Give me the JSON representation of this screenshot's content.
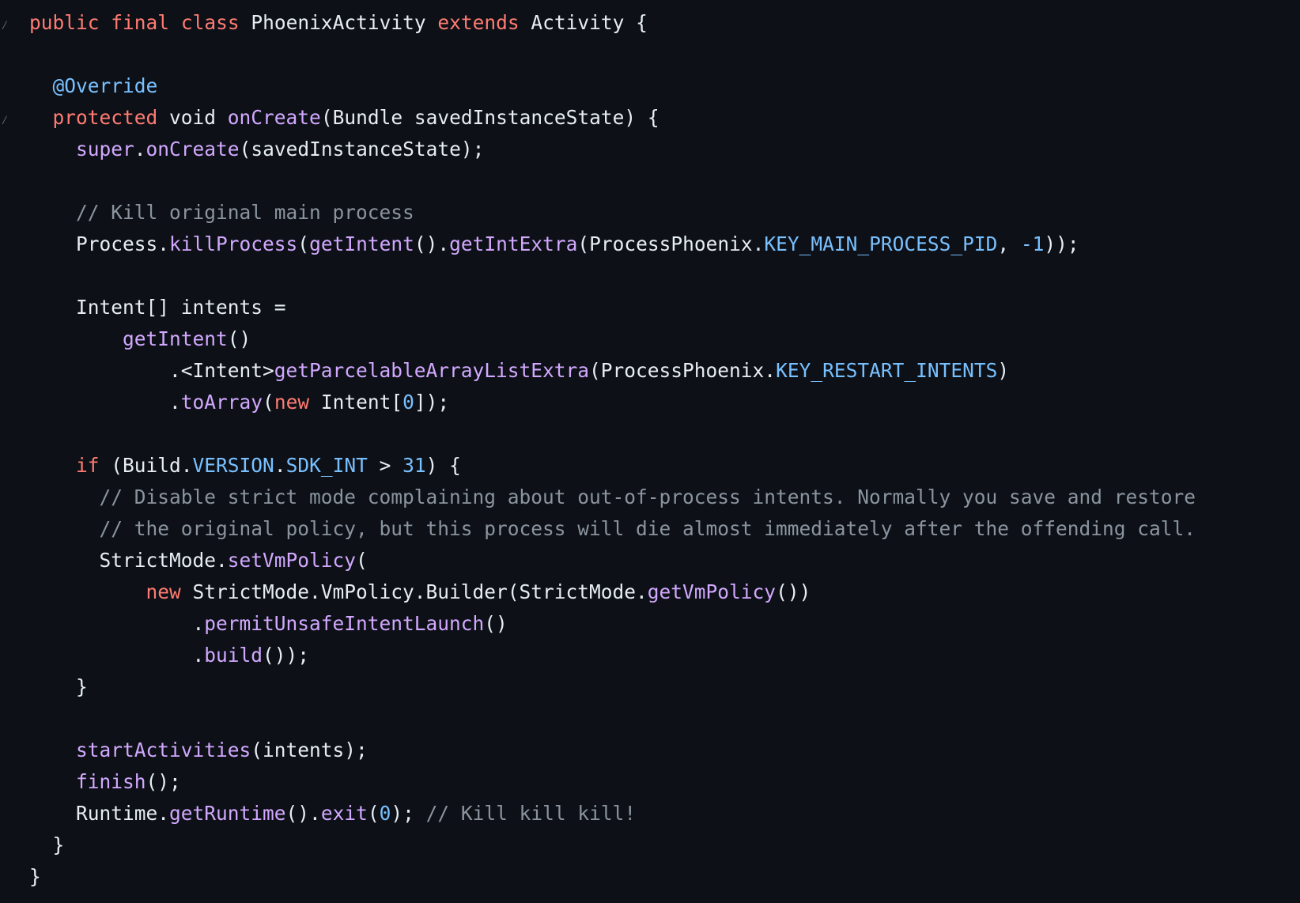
{
  "theme": {
    "background": "#0d1117",
    "text": "#e6edf3",
    "keyword": "#ff7b72",
    "function": "#d2a8ff",
    "constant": "#79c0ff",
    "comment": "#8b949e"
  },
  "code": {
    "language": "java",
    "fold_icon": "fold-chevron-icon",
    "lines": [
      {
        "fold": true,
        "indent": "",
        "tokens": [
          {
            "t": "public",
            "k": "kw"
          },
          {
            "t": " ",
            "k": "pl"
          },
          {
            "t": "final",
            "k": "kw"
          },
          {
            "t": " ",
            "k": "pl"
          },
          {
            "t": "class",
            "k": "kw"
          },
          {
            "t": " PhoenixActivity ",
            "k": "pl"
          },
          {
            "t": "extends",
            "k": "kw"
          },
          {
            "t": " Activity {",
            "k": "pl"
          }
        ]
      },
      {
        "fold": false,
        "indent": "",
        "tokens": []
      },
      {
        "fold": false,
        "indent": "  ",
        "tokens": [
          {
            "t": "@Override",
            "k": "an"
          }
        ]
      },
      {
        "fold": true,
        "indent": "  ",
        "tokens": [
          {
            "t": "protected",
            "k": "kw"
          },
          {
            "t": " void ",
            "k": "pl"
          },
          {
            "t": "onCreate",
            "k": "fn"
          },
          {
            "t": "(Bundle savedInstanceState) {",
            "k": "pl"
          }
        ]
      },
      {
        "fold": false,
        "indent": "    ",
        "tokens": [
          {
            "t": "super",
            "k": "fn"
          },
          {
            "t": ".",
            "k": "pl"
          },
          {
            "t": "onCreate",
            "k": "fn"
          },
          {
            "t": "(savedInstanceState);",
            "k": "pl"
          }
        ]
      },
      {
        "fold": false,
        "indent": "",
        "tokens": []
      },
      {
        "fold": false,
        "indent": "    ",
        "tokens": [
          {
            "t": "// Kill original main process",
            "k": "cm"
          }
        ]
      },
      {
        "fold": false,
        "indent": "    ",
        "tokens": [
          {
            "t": "Process.",
            "k": "pl"
          },
          {
            "t": "killProcess",
            "k": "fn"
          },
          {
            "t": "(",
            "k": "pl"
          },
          {
            "t": "getIntent",
            "k": "fn"
          },
          {
            "t": "().",
            "k": "pl"
          },
          {
            "t": "getIntExtra",
            "k": "fn"
          },
          {
            "t": "(ProcessPhoenix.",
            "k": "pl"
          },
          {
            "t": "KEY_MAIN_PROCESS_PID",
            "k": "cst"
          },
          {
            "t": ", ",
            "k": "pl"
          },
          {
            "t": "-1",
            "k": "num"
          },
          {
            "t": "));",
            "k": "pl"
          }
        ]
      },
      {
        "fold": false,
        "indent": "",
        "tokens": []
      },
      {
        "fold": false,
        "indent": "    ",
        "tokens": [
          {
            "t": "Intent[] intents =",
            "k": "pl"
          }
        ]
      },
      {
        "fold": false,
        "indent": "        ",
        "tokens": [
          {
            "t": "getIntent",
            "k": "fn"
          },
          {
            "t": "()",
            "k": "pl"
          }
        ]
      },
      {
        "fold": false,
        "indent": "            ",
        "tokens": [
          {
            "t": ".<Intent>",
            "k": "pl"
          },
          {
            "t": "getParcelableArrayListExtra",
            "k": "fn"
          },
          {
            "t": "(ProcessPhoenix.",
            "k": "pl"
          },
          {
            "t": "KEY_RESTART_INTENTS",
            "k": "cst"
          },
          {
            "t": ")",
            "k": "pl"
          }
        ]
      },
      {
        "fold": false,
        "indent": "            ",
        "tokens": [
          {
            "t": ".",
            "k": "pl"
          },
          {
            "t": "toArray",
            "k": "fn"
          },
          {
            "t": "(",
            "k": "pl"
          },
          {
            "t": "new",
            "k": "kw"
          },
          {
            "t": " Intent[",
            "k": "pl"
          },
          {
            "t": "0",
            "k": "num"
          },
          {
            "t": "]);",
            "k": "pl"
          }
        ]
      },
      {
        "fold": false,
        "indent": "",
        "tokens": []
      },
      {
        "fold": false,
        "indent": "    ",
        "tokens": [
          {
            "t": "if",
            "k": "kw"
          },
          {
            "t": " (Build.",
            "k": "pl"
          },
          {
            "t": "VERSION",
            "k": "cst"
          },
          {
            "t": ".",
            "k": "pl"
          },
          {
            "t": "SDK_INT",
            "k": "cst"
          },
          {
            "t": " > ",
            "k": "pl"
          },
          {
            "t": "31",
            "k": "num"
          },
          {
            "t": ") {",
            "k": "pl"
          }
        ]
      },
      {
        "fold": false,
        "indent": "      ",
        "tokens": [
          {
            "t": "// Disable strict mode complaining about out-of-process intents. Normally you save and restore",
            "k": "cm"
          }
        ]
      },
      {
        "fold": false,
        "indent": "      ",
        "tokens": [
          {
            "t": "// the original policy, but this process will die almost immediately after the offending call.",
            "k": "cm"
          }
        ]
      },
      {
        "fold": false,
        "indent": "      ",
        "tokens": [
          {
            "t": "StrictMode.",
            "k": "pl"
          },
          {
            "t": "setVmPolicy",
            "k": "fn"
          },
          {
            "t": "(",
            "k": "pl"
          }
        ]
      },
      {
        "fold": false,
        "indent": "          ",
        "tokens": [
          {
            "t": "new",
            "k": "kw"
          },
          {
            "t": " StrictMode.VmPolicy.Builder(StrictMode.",
            "k": "pl"
          },
          {
            "t": "getVmPolicy",
            "k": "fn"
          },
          {
            "t": "())",
            "k": "pl"
          }
        ]
      },
      {
        "fold": false,
        "indent": "              ",
        "tokens": [
          {
            "t": ".",
            "k": "pl"
          },
          {
            "t": "permitUnsafeIntentLaunch",
            "k": "fn"
          },
          {
            "t": "()",
            "k": "pl"
          }
        ]
      },
      {
        "fold": false,
        "indent": "              ",
        "tokens": [
          {
            "t": ".",
            "k": "pl"
          },
          {
            "t": "build",
            "k": "fn"
          },
          {
            "t": "());",
            "k": "pl"
          }
        ]
      },
      {
        "fold": false,
        "indent": "    ",
        "tokens": [
          {
            "t": "}",
            "k": "pl"
          }
        ]
      },
      {
        "fold": false,
        "indent": "",
        "tokens": []
      },
      {
        "fold": false,
        "indent": "    ",
        "tokens": [
          {
            "t": "startActivities",
            "k": "fn"
          },
          {
            "t": "(intents);",
            "k": "pl"
          }
        ]
      },
      {
        "fold": false,
        "indent": "    ",
        "tokens": [
          {
            "t": "finish",
            "k": "fn"
          },
          {
            "t": "();",
            "k": "pl"
          }
        ]
      },
      {
        "fold": false,
        "indent": "    ",
        "tokens": [
          {
            "t": "Runtime.",
            "k": "pl"
          },
          {
            "t": "getRuntime",
            "k": "fn"
          },
          {
            "t": "().",
            "k": "pl"
          },
          {
            "t": "exit",
            "k": "fn"
          },
          {
            "t": "(",
            "k": "pl"
          },
          {
            "t": "0",
            "k": "num"
          },
          {
            "t": "); ",
            "k": "pl"
          },
          {
            "t": "// Kill kill kill!",
            "k": "cm"
          }
        ]
      },
      {
        "fold": false,
        "indent": "  ",
        "tokens": [
          {
            "t": "}",
            "k": "pl"
          }
        ]
      },
      {
        "fold": false,
        "indent": "",
        "tokens": [
          {
            "t": "}",
            "k": "pl"
          }
        ]
      }
    ]
  }
}
